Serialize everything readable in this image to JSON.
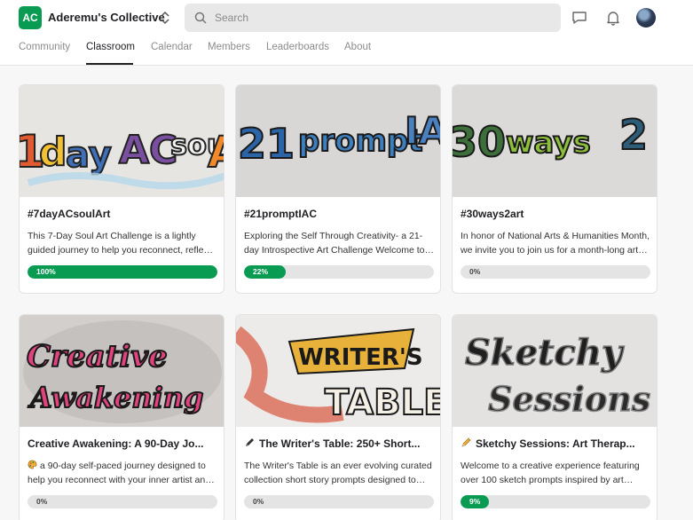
{
  "header": {
    "logo_initials": "AC",
    "group_name": "Aderemu's Collective",
    "search_placeholder": "Search",
    "brand_color": "#0a9b53"
  },
  "tabs": [
    {
      "label": "Community",
      "active": false
    },
    {
      "label": "Classroom",
      "active": true
    },
    {
      "label": "Calendar",
      "active": false
    },
    {
      "label": "Members",
      "active": false
    },
    {
      "label": "Leaderboards",
      "active": false
    },
    {
      "label": "About",
      "active": false
    }
  ],
  "courses": [
    {
      "title": "#7dayACsoulArt",
      "description": "This 7-Day Soul Art Challenge is a lightly guided journey to help you reconnect, reflect, and create.",
      "progress": "100%",
      "progress_value": 100,
      "cover_text": "7dayACsoulA"
    },
    {
      "title": "#21promptIAC",
      "description": "Exploring the Self Through Creativity- a 21-day Introspective Art Challenge Welcome to the challenge.",
      "progress": "22%",
      "progress_value": 22,
      "cover_text": "21promptIA"
    },
    {
      "title": "#30ways2art",
      "description": "In honor of National Arts & Humanities Month, we invite you to join us for a month-long art journey.",
      "progress": "0%",
      "progress_value": 0,
      "cover_text": "30 ways 2"
    },
    {
      "title": "Creative Awakening: A 90-Day Jo...",
      "description": "a 90-day self-paced journey designed to help you reconnect with your inner artist and creativity.",
      "progress": "0%",
      "progress_value": 0,
      "cover_text": "Creative Awakening",
      "title_icon": "",
      "desc_icon": "artist-palette-icon"
    },
    {
      "title": "The Writer's Table: 250+ Short...",
      "description": "The Writer's Table is an ever evolving curated collection short story prompts designed to inspire.",
      "progress": "0%",
      "progress_value": 0,
      "cover_text": "Writer's Table",
      "title_icon": "pen-icon"
    },
    {
      "title": "Sketchy Sessions: Art Therap...",
      "description": "Welcome to a creative experience featuring over 100 sketch prompts inspired by art therapy.",
      "progress": "9%",
      "progress_value": 9,
      "cover_text": "Sketchy Sessions",
      "title_icon": "pencil-icon"
    }
  ]
}
